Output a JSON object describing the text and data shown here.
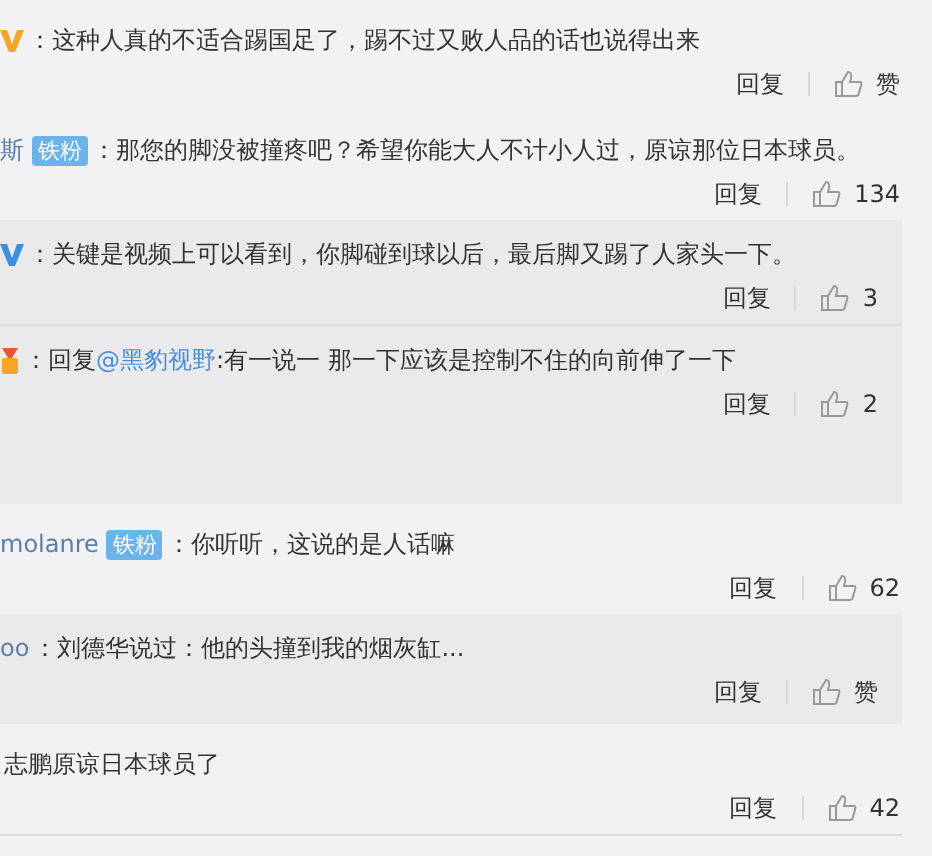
{
  "comments": [
    {
      "kind": "verified_orange",
      "text": "：这种人真的不适合踢国足了，踢不过又败人品的话也说得出来",
      "reply": "回复",
      "likes": "赞"
    },
    {
      "author": "斯",
      "badge": "铁粉",
      "text": "：那您的脚没被撞疼吧？希望你能大人不计小人过，原谅那位日本球员。",
      "reply": "回复",
      "likes": "134",
      "replies": [
        {
          "kind": "verified_blue",
          "text": "：关键是视频上可以看到，你脚碰到球以后，最后脚又踢了人家头一下。",
          "reply": "回复",
          "likes": "3"
        },
        {
          "kind": "medal",
          "text": "：回复",
          "mention": "@黑豹视野",
          "text_after": ":有一说一 那一下应该是控制不住的向前伸了一下",
          "reply": "回复",
          "likes": "2"
        }
      ]
    },
    {
      "author": "molanre",
      "badge": "铁粉",
      "text": "：你听听，这说的是人话嘛",
      "reply": "回复",
      "likes": "62",
      "replies": [
        {
          "author": "oo",
          "text": "：刘德华说过：他的头撞到我的烟灰缸...",
          "reply": "回复",
          "likes": "赞"
        }
      ]
    },
    {
      "text": "志鹏原谅日本球员了",
      "reply": "回复",
      "likes": "42"
    }
  ]
}
